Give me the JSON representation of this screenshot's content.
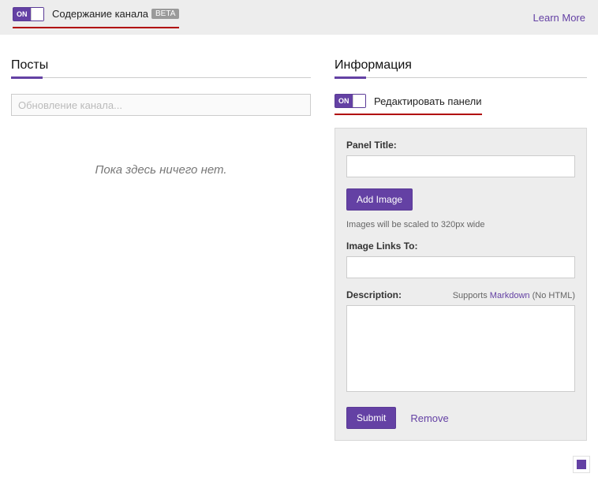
{
  "topbar": {
    "toggle_state": "ON",
    "label": "Содержание канала",
    "badge": "BETA",
    "learn_more": "Learn More"
  },
  "posts": {
    "title": "Посты",
    "placeholder": "Обновление канала...",
    "empty": "Пока здесь ничего нет."
  },
  "info": {
    "title": "Информация",
    "toggle_state": "ON",
    "edit_label": "Редактировать панели"
  },
  "panel": {
    "title_label": "Panel Title:",
    "title_value": "",
    "add_image": "Add Image",
    "scale_hint": "Images will be scaled to 320px wide",
    "links_label": "Image Links To:",
    "links_value": "",
    "desc_label": "Description:",
    "supports_prefix": "Supports ",
    "supports_link": "Markdown",
    "supports_suffix": " (No HTML)",
    "desc_value": "",
    "submit": "Submit",
    "remove": "Remove"
  }
}
